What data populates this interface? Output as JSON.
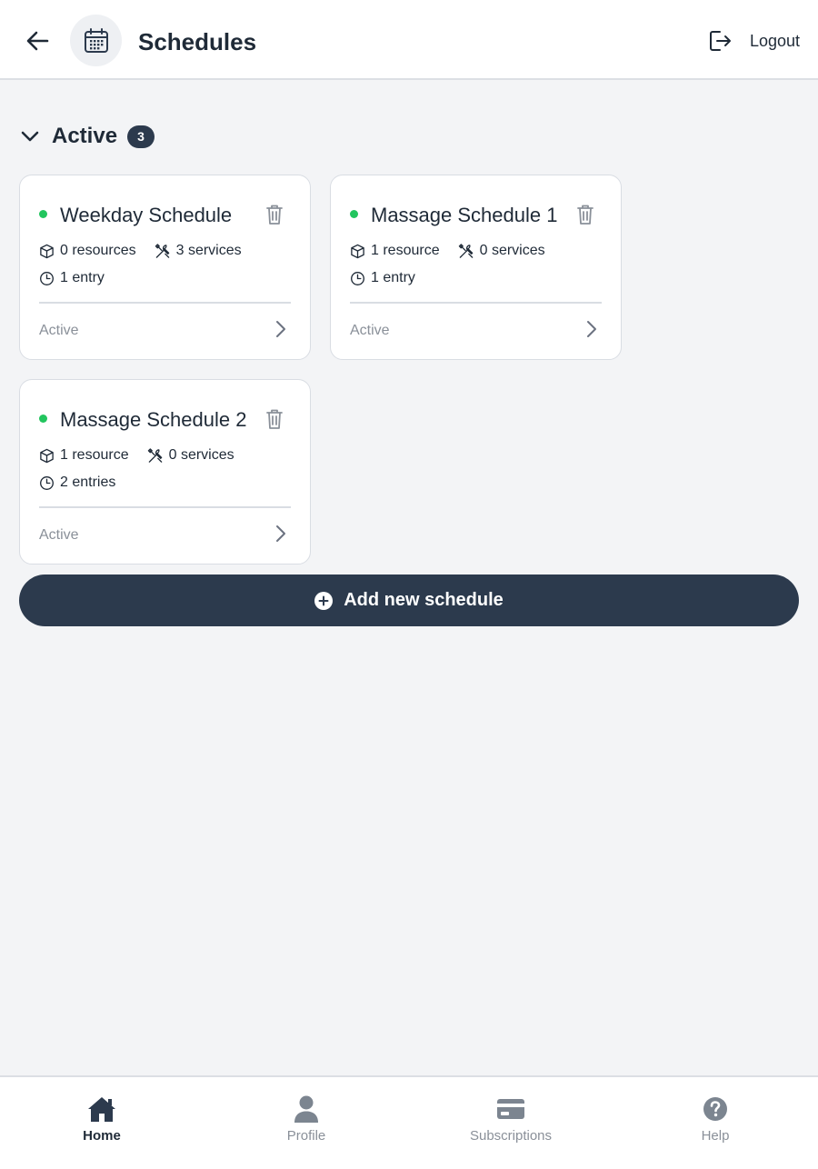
{
  "header": {
    "title": "Schedules",
    "back_icon": "arrow-left-icon",
    "title_icon": "calendar-icon",
    "logout_label": "Logout",
    "logout_icon": "logout-icon"
  },
  "section": {
    "title": "Active",
    "count": "3",
    "toggle_icon": "chevron-down-icon"
  },
  "schedules": [
    {
      "name": "Weekday Schedule",
      "resources": "0 resources",
      "services": "3 services",
      "entries": "1 entry",
      "status": "Active"
    },
    {
      "name": "Massage Schedule 1",
      "resources": "1 resource",
      "services": "0 services",
      "entries": "1 entry",
      "status": "Active"
    },
    {
      "name": "Massage Schedule 2",
      "resources": "1 resource",
      "services": "0 services",
      "entries": "2 entries",
      "status": "Active"
    }
  ],
  "add_button": {
    "label": "Add new schedule",
    "icon": "plus-circle-icon"
  },
  "bottom_nav": {
    "items": [
      {
        "label": "Home",
        "icon": "home-icon",
        "active": true
      },
      {
        "label": "Profile",
        "icon": "user-icon",
        "active": false
      },
      {
        "label": "Subscriptions",
        "icon": "credit-card-icon",
        "active": false
      },
      {
        "label": "Help",
        "icon": "help-circle-icon",
        "active": false
      }
    ]
  },
  "colors": {
    "primary": "#2c3a4d",
    "status_dot": "#22c55e",
    "background": "#f3f4f6",
    "muted_text": "#8a9099"
  }
}
